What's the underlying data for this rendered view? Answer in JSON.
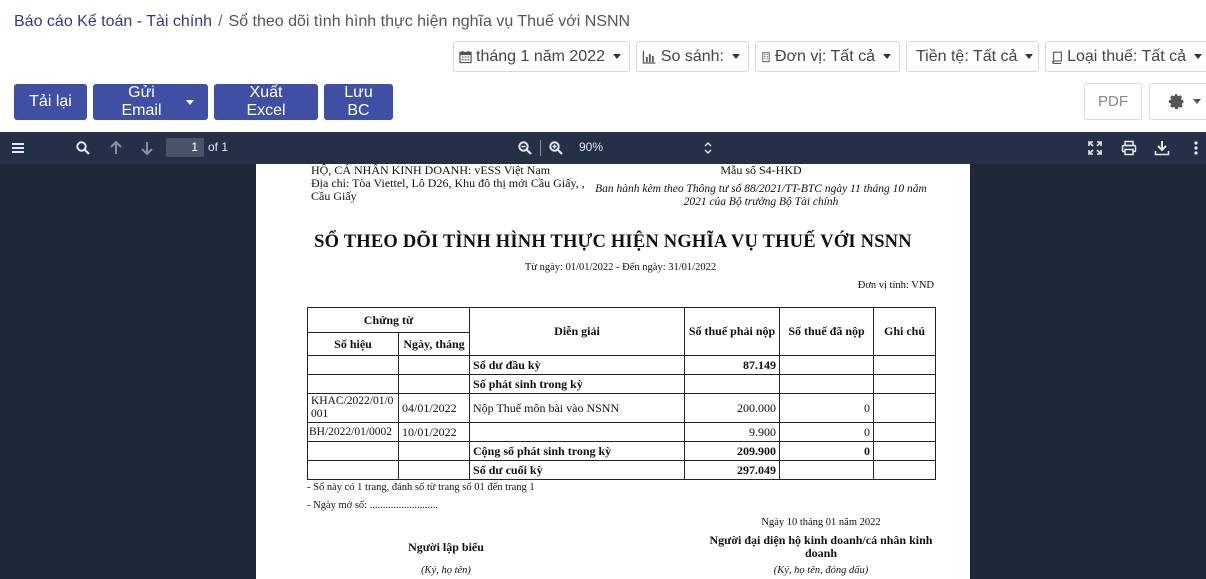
{
  "breadcrumb": {
    "parent": "Báo cáo Kế toán - Tài chính",
    "separator": "/",
    "current": "Sổ theo dõi tình hình thực hiện nghĩa vụ Thuế với NSNN"
  },
  "filters": {
    "period": "tháng 1 năm 2022",
    "compare": "So sánh:",
    "unit": "Đơn vị: Tất cả",
    "currency": "Tiền tệ: Tất cả",
    "tax_type": "Loại thuế: Tất cả"
  },
  "actions": {
    "reload": "Tải lại",
    "send_email": "Gửi Email",
    "export_excel": "Xuất Excel",
    "save": "Lưu BC",
    "pdf": "PDF"
  },
  "viewer": {
    "current_page": "1",
    "page_total": "of 1",
    "zoom": "90%"
  },
  "document": {
    "business_name": "HỘ, CÁ NHÂN KINH DOANH: vESS Việt Nam",
    "address": "Địa chỉ: Tòa Viettel, Lô D26, Khu đô thị mới Cầu Giấy, , Cầu Giấy",
    "form_code": "Mẫu số S4-HKD",
    "form_issued": "Ban hành kèm theo Thông tư số 88/2021/TT-BTC ngày 11 tháng 10 năm 2021 của Bộ trưởng Bộ Tài chính",
    "title": "SỔ THEO DÕI TÌNH HÌNH THỰC HIỆN NGHĨA VỤ THUẾ VỚI NSNN",
    "date_range": "Từ ngày: 01/01/2022 - Đến ngày: 31/01/2022",
    "currency_unit": "Đơn vị tính: VND",
    "table": {
      "headers": {
        "voucher": "Chứng từ",
        "voucher_no": "Số hiệu",
        "voucher_date": "Ngày, tháng",
        "description": "Diễn giải",
        "payable": "Số thuế phải nộp",
        "paid": "Số thuế đã nộp",
        "note": "Ghi chú"
      },
      "rows": [
        {
          "no": "",
          "date": "",
          "desc": "Số dư đầu kỳ",
          "payable": "87.149",
          "paid": "",
          "note": ""
        },
        {
          "no": "",
          "date": "",
          "desc": "Số phát sinh trong kỳ",
          "payable": "",
          "paid": "",
          "note": ""
        },
        {
          "no": "KHAC/2022/01/0001",
          "date": "04/01/2022",
          "desc": "Nộp Thuế môn bài vào NSNN",
          "payable": "200.000",
          "paid": "0",
          "note": ""
        },
        {
          "no": "BH/2022/01/0002",
          "date": "10/01/2022",
          "desc": "",
          "payable": "9.900",
          "paid": "0",
          "note": ""
        },
        {
          "no": "",
          "date": "",
          "desc": "Cộng số phát sinh trong kỳ",
          "payable": "209.900",
          "paid": "0",
          "note": ""
        },
        {
          "no": "",
          "date": "",
          "desc": "Số dư cuối kỳ",
          "payable": "297.049",
          "paid": "",
          "note": ""
        }
      ]
    },
    "note_pages": "- Sổ này có 1 trang, đánh số từ trang số 01 đến trang 1",
    "note_open_date": "- Ngày mở sổ: ..........................",
    "sign_date": "Ngày 10 tháng 01 năm 2022",
    "preparer": "Người lập biểu",
    "representative": "Người đại diện hộ kinh doanh/cá nhân kinh doanh",
    "preparer_hint": "(Ký, họ tên)",
    "representative_hint": "(Ký, họ tên, đóng dấu)"
  }
}
